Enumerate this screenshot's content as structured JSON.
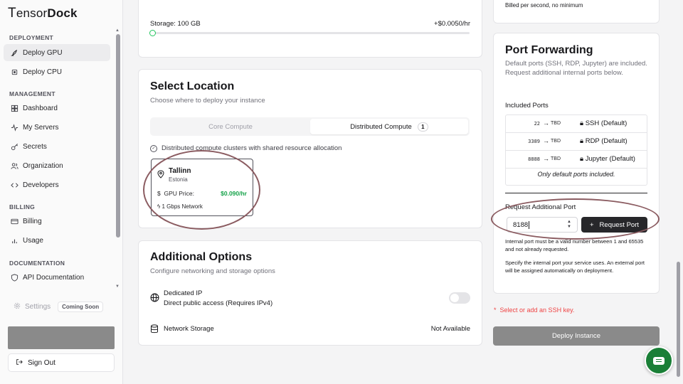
{
  "brand": {
    "logo_t": "T",
    "logo_tensor": "ensor",
    "logo_dock": "Dock"
  },
  "sidebar": {
    "sections": [
      {
        "label": "DEPLOYMENT"
      },
      {
        "label": "MANAGEMENT"
      },
      {
        "label": "BILLING"
      },
      {
        "label": "DOCUMENTATION"
      }
    ],
    "items": [
      {
        "label": "Deploy GPU",
        "icon": "rocket-icon",
        "active": true
      },
      {
        "label": "Deploy CPU",
        "icon": "cpu-icon"
      },
      {
        "label": "Dashboard",
        "icon": "dashboard-icon"
      },
      {
        "label": "My Servers",
        "icon": "activity-icon"
      },
      {
        "label": "Secrets",
        "icon": "key-icon"
      },
      {
        "label": "Organization",
        "icon": "users-icon"
      },
      {
        "label": "Developers",
        "icon": "code-icon"
      },
      {
        "label": "Billing",
        "icon": "credit-card-icon"
      },
      {
        "label": "Usage",
        "icon": "bar-chart-icon"
      },
      {
        "label": "API Documentation",
        "icon": "shield-icon"
      }
    ],
    "settings_label": "Settings",
    "coming_soon": "Coming Soon",
    "sign_out": "Sign Out"
  },
  "storage": {
    "label": "Storage: 100 GB",
    "price": "+$0.0050/hr",
    "slider_fraction": 0.0
  },
  "location": {
    "title": "Select Location",
    "subtitle": "Choose where to deploy your instance",
    "tabs": [
      {
        "label": "Core Compute",
        "selected": false
      },
      {
        "label": "Distributed Compute",
        "badge": "1",
        "selected": true
      }
    ],
    "note": "Distributed compute clusters with shared resource allocation",
    "card": {
      "city": "Tallinn",
      "country": "Estonia",
      "gpu_price_label": "GPU Price:",
      "gpu_price": "$0.090/hr",
      "network": "1 Gbps Network"
    }
  },
  "additional": {
    "title": "Additional Options",
    "subtitle": "Configure networking and storage options",
    "dedicated_ip_title": "Dedicated IP",
    "dedicated_ip_desc": "Direct public access (Requires IPv4)",
    "dedicated_ip_enabled": false,
    "network_storage": "Network Storage",
    "network_storage_status": "Not Available"
  },
  "right": {
    "billed_note": "Billed per second, no minimum",
    "port_forwarding": {
      "title": "Port Forwarding",
      "description": "Default ports (SSH, RDP, Jupyter) are included. Request additional internal ports below.",
      "included_label": "Included Ports",
      "ports": [
        {
          "internal": "22",
          "external": "TBD",
          "name": "SSH (Default)"
        },
        {
          "internal": "3389",
          "external": "TBD",
          "name": "RDP (Default)"
        },
        {
          "internal": "8888",
          "external": "TBD",
          "name": "Jupyter (Default)"
        }
      ],
      "only_default": "Only default ports included.",
      "request_label": "Request Additional Port",
      "port_value": "8188",
      "request_button": "Request Port",
      "validation": "Internal port must be a valid number between 1 and 65535 and not already requested.",
      "help": "Specify the internal port your service uses. An external port will be assigned automatically on deployment."
    },
    "ssh_warning": "Select or add an SSH key.",
    "deploy_button": "Deploy Instance"
  },
  "colors": {
    "accent_green": "#16a34a",
    "annotation": "#8b5c61",
    "warning": "#ef4444"
  }
}
